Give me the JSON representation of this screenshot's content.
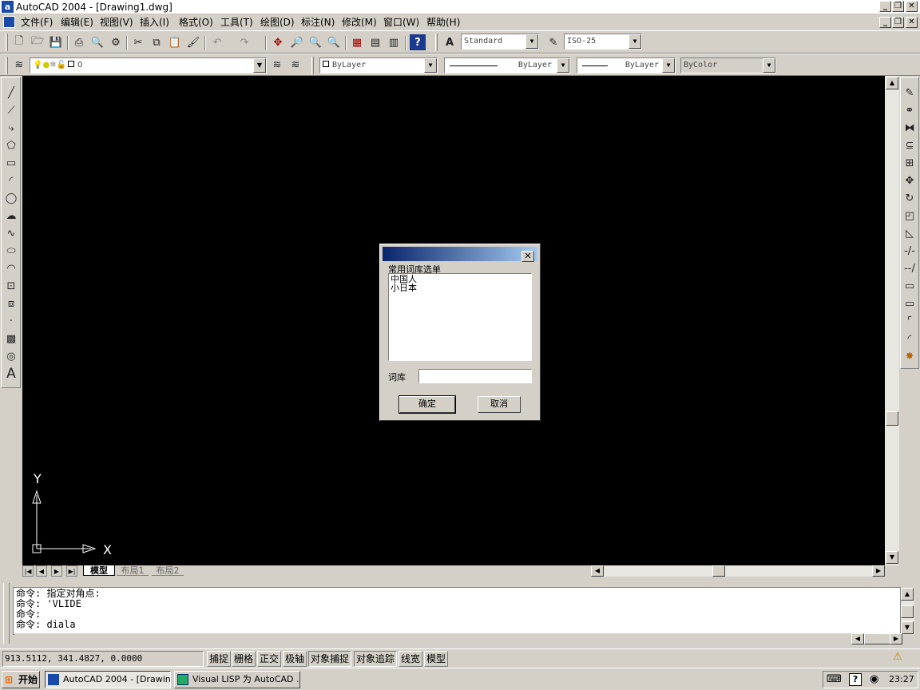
{
  "window": {
    "app_icon": "a",
    "title": "AutoCAD 2004 - [Drawing1.dwg]"
  },
  "menu": [
    "文件(F)",
    "编辑(E)",
    "视图(V)",
    "插入(I)",
    "格式(O)",
    "工具(T)",
    "绘图(D)",
    "标注(N)",
    "修改(M)",
    "窗口(W)",
    "帮助(H)"
  ],
  "toolbar": {
    "text_style": "Standard",
    "dim_style": "ISO-25",
    "layer": "0",
    "color": "ByLayer",
    "linetype": "ByLayer",
    "lineweight": "ByLayer",
    "plotstyle": "ByColor"
  },
  "canvas": {
    "ucs_y": "Y",
    "ucs_x": "X",
    "tabs": [
      "模型",
      "布局1",
      "布局2"
    ]
  },
  "dialog": {
    "list_label": "常用词库选单",
    "items": [
      "中国人",
      "小日本"
    ],
    "field_label": "词库",
    "field_value": "",
    "ok": "确定",
    "cancel": "取消"
  },
  "command": {
    "lines": [
      "命令: 指定对角点:",
      "命令: 'VLIDE",
      "命令:",
      "命令: diala"
    ]
  },
  "status": {
    "coords": "913.5112,  341.4827,  0.0000",
    "toggles": [
      "捕捉",
      "栅格",
      "正交",
      "极轴",
      "对象捕捉",
      "对象追踪",
      "线宽",
      "模型"
    ]
  },
  "taskbar": {
    "start": "开始",
    "tasks": [
      "AutoCAD 2004 - [Drawin...",
      "Visual LISP 为 AutoCAD ..."
    ],
    "clock": "23:27"
  }
}
